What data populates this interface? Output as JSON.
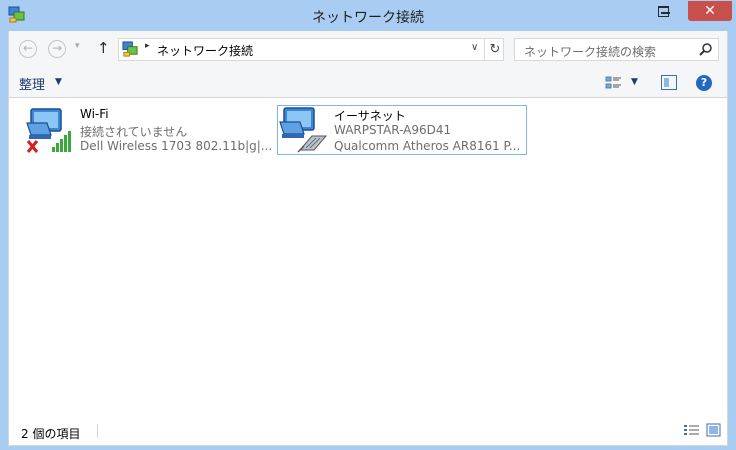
{
  "window": {
    "title": "ネットワーク接続"
  },
  "titlebar": {
    "minimize_glyph": "",
    "close_glyph": "✕"
  },
  "nav": {
    "back": "←",
    "forward": "→",
    "recent": "▾",
    "up": "↑"
  },
  "address": {
    "separator": "▸",
    "path": "ネットワーク接続",
    "dropdown": "∨",
    "refresh": "↻"
  },
  "search": {
    "placeholder": "ネットワーク接続の検索"
  },
  "toolbar": {
    "organize_label": "整理",
    "organize_arrow": "▼",
    "view_arrow": "▼",
    "help_label": "?"
  },
  "items": [
    {
      "name": "Wi-Fi",
      "status": "接続されていません",
      "device": "Dell Wireless 1703 802.11b|g|...",
      "icon": "wifi-adapter-disconnected-icon"
    },
    {
      "name": "イーサネット",
      "status": "WARPSTAR-A96D41",
      "device": "Qualcomm Atheros AR8161 P...",
      "icon": "ethernet-adapter-icon"
    }
  ],
  "statusbar": {
    "count": "2 個の項目"
  },
  "colors": {
    "frame": "#a9cdf2",
    "close_button": "#c7504c",
    "selection_border": "#7fb5e8",
    "link_text": "#1f3a6a"
  }
}
